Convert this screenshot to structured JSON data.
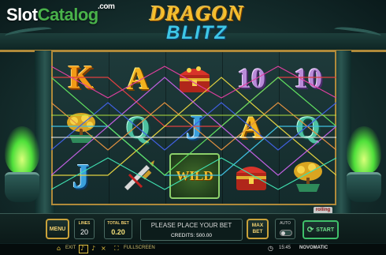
{
  "watermark": {
    "part1": "Slot",
    "part2": "Catalog",
    "suffix": ".com"
  },
  "game_logo": {
    "line1": "DRAGON",
    "line2": "BLITZ"
  },
  "reels": {
    "col1": {
      "top": "K",
      "middle": "money-tree-symbol",
      "bottom": "J"
    },
    "col2": {
      "top": "A",
      "middle": "Q",
      "bottom": "dagger-symbol"
    },
    "col3": {
      "top": "treasure-chest-symbol",
      "middle": "J",
      "bottom": "WILD"
    },
    "col4": {
      "top": "10",
      "middle": "A",
      "bottom": "treasure-chest-symbol"
    },
    "col5": {
      "top": "10",
      "middle": "Q",
      "bottom": "money-tree-symbol"
    }
  },
  "brand_badge": "rolling",
  "controls": {
    "menu_label": "MENU",
    "lines_label": "LINES",
    "lines_value": "20",
    "total_bet_label": "TOTAL BET",
    "total_bet_value": "0.20",
    "message": "PLEASE PLACE YOUR BET",
    "credits_label": "CREDITS:",
    "credits_value": "500.00",
    "max_bet_label_1": "MAX",
    "max_bet_label_2": "BET",
    "auto_label": "AUTO",
    "start_label": "START"
  },
  "bottom_bar": {
    "exit_label": "EXIT",
    "fullscreen_label": "FULLSCREEN",
    "time": "15:45",
    "brand": "NOVOMATIC"
  },
  "colors": {
    "gold": "#c9a23a",
    "wild_green": "#8ccf6a",
    "flame_green": "#4fe03a"
  }
}
